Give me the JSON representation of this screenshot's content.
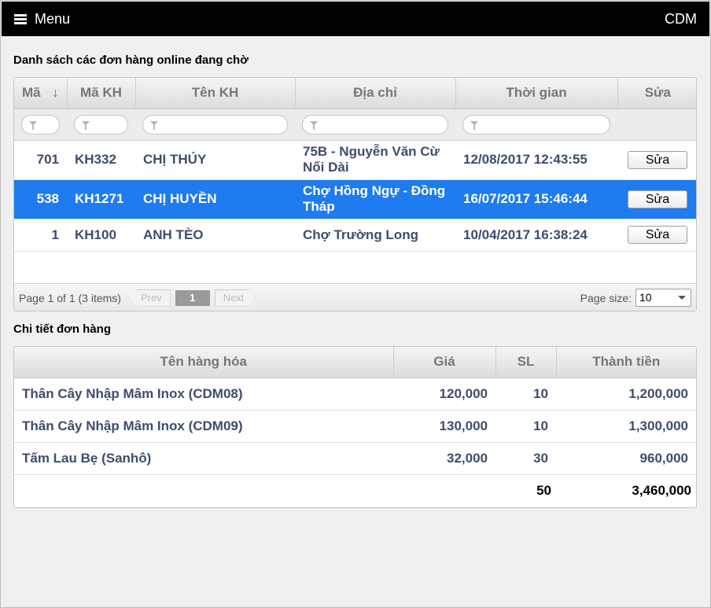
{
  "header": {
    "menu_label": "Menu",
    "brand": "CDM"
  },
  "orders_section": {
    "title": "Danh sách các đơn hàng online đang chờ",
    "columns": [
      "Mã",
      "Mã KH",
      "Tên KH",
      "Địa chỉ",
      "Thời gian",
      "Sửa"
    ],
    "rows": [
      {
        "id": "701",
        "customer_code": "KH332",
        "customer_name": "CHỊ THÚY",
        "address": "75B - Nguyễn Văn Cừ Nối Dài",
        "time": "12/08/2017 12:43:55",
        "edit_label": "Sửa",
        "selected": false
      },
      {
        "id": "538",
        "customer_code": "KH1271",
        "customer_name": "CHỊ HUYỀN",
        "address": "Chợ Hồng Ngự - Đồng Tháp",
        "time": "16/07/2017 15:46:44",
        "edit_label": "Sửa",
        "selected": true
      },
      {
        "id": "1",
        "customer_code": "KH100",
        "customer_name": "ANH TÈO",
        "address": "Chợ Trường Long",
        "time": "10/04/2017 16:38:24",
        "edit_label": "Sửa",
        "selected": false
      }
    ],
    "pager": {
      "info": "Page 1 of 1 (3 items)",
      "prev": "Prev",
      "page": "1",
      "next": "Next",
      "size_label": "Page size:",
      "size_value": "10"
    }
  },
  "details_section": {
    "title": "Chi tiết đơn hàng",
    "columns": [
      "Tên hàng hóa",
      "Giá",
      "SL",
      "Thành tiền"
    ],
    "rows": [
      {
        "name": "Thân Cây Nhập Mâm Inox (CDM08)",
        "price": "120,000",
        "qty": "10",
        "amount": "1,200,000"
      },
      {
        "name": "Thân Cây Nhập Mâm Inox (CDM09)",
        "price": "130,000",
        "qty": "10",
        "amount": "1,300,000"
      },
      {
        "name": "Tấm Lau Bẹ (Sanhô)",
        "price": "32,000",
        "qty": "30",
        "amount": "960,000"
      }
    ],
    "totals": {
      "qty": "50",
      "amount": "3,460,000"
    }
  },
  "colors": {
    "selected_row": "#1e7bf0",
    "topbar": "#000000",
    "text": "#3e4d6c"
  }
}
